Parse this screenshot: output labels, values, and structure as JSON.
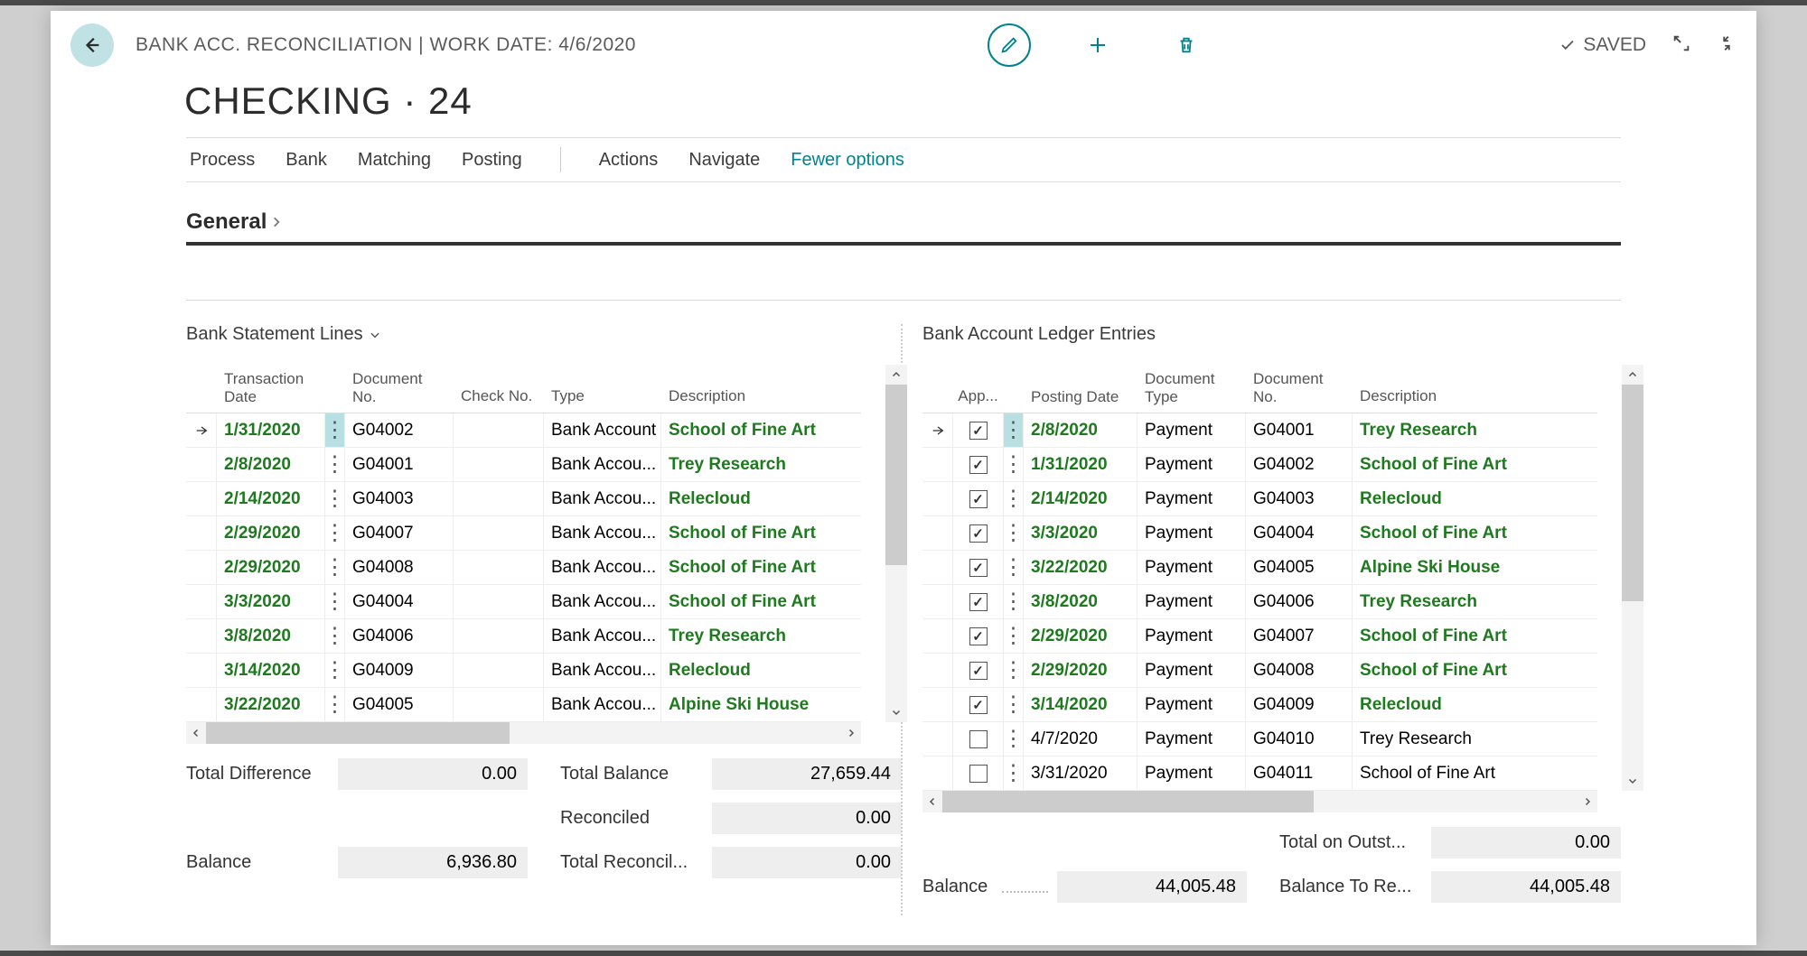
{
  "header": {
    "breadcrumb": "BANK ACC. RECONCILIATION | WORK DATE: 4/6/2020",
    "saved": "SAVED",
    "page_title": "CHECKING · 24"
  },
  "menu": {
    "process": "Process",
    "bank": "Bank",
    "matching": "Matching",
    "posting": "Posting",
    "actions": "Actions",
    "navigate": "Navigate",
    "fewer": "Fewer options"
  },
  "section": {
    "general": "General"
  },
  "left_panel": {
    "title": "Bank Statement Lines",
    "columns": {
      "transaction_date": "Transaction Date",
      "document_no": "Document No.",
      "check_no": "Check No.",
      "type": "Type",
      "description": "Description"
    },
    "rows": [
      {
        "date": "1/31/2020",
        "doc": "G04002",
        "check": "",
        "type": "Bank Account",
        "desc": "School of Fine Art",
        "matched": true,
        "selected": true
      },
      {
        "date": "2/8/2020",
        "doc": "G04001",
        "check": "",
        "type": "Bank Accou...",
        "desc": "Trey Research",
        "matched": true
      },
      {
        "date": "2/14/2020",
        "doc": "G04003",
        "check": "",
        "type": "Bank Accou...",
        "desc": "Relecloud",
        "matched": true
      },
      {
        "date": "2/29/2020",
        "doc": "G04007",
        "check": "",
        "type": "Bank Accou...",
        "desc": "School of Fine Art",
        "matched": true
      },
      {
        "date": "2/29/2020",
        "doc": "G04008",
        "check": "",
        "type": "Bank Accou...",
        "desc": "School of Fine Art",
        "matched": true
      },
      {
        "date": "3/3/2020",
        "doc": "G04004",
        "check": "",
        "type": "Bank Accou...",
        "desc": "School of Fine Art",
        "matched": true
      },
      {
        "date": "3/8/2020",
        "doc": "G04006",
        "check": "",
        "type": "Bank Accou...",
        "desc": "Trey Research",
        "matched": true
      },
      {
        "date": "3/14/2020",
        "doc": "G04009",
        "check": "",
        "type": "Bank Accou...",
        "desc": "Relecloud",
        "matched": true
      },
      {
        "date": "3/22/2020",
        "doc": "G04005",
        "check": "",
        "type": "Bank Accou...",
        "desc": "Alpine Ski House",
        "matched": true
      }
    ],
    "totals": {
      "total_difference_lbl": "Total Difference",
      "total_difference_val": "0.00",
      "total_balance_lbl": "Total Balance",
      "total_balance_val": "27,659.44",
      "reconciled_lbl": "Reconciled",
      "reconciled_val": "0.00",
      "balance_lbl": "Balance",
      "balance_val": "6,936.80",
      "total_reconcil_lbl": "Total Reconcil...",
      "total_reconcil_val": "0.00"
    }
  },
  "right_panel": {
    "title": "Bank Account Ledger Entries",
    "columns": {
      "app": "App...",
      "posting_date": "Posting Date",
      "document_type": "Document Type",
      "document_no": "Document No.",
      "description": "Description"
    },
    "rows": [
      {
        "app": true,
        "date": "2/8/2020",
        "dtype": "Payment",
        "doc": "G04001",
        "desc": "Trey Research",
        "matched": true,
        "selected": true
      },
      {
        "app": true,
        "date": "1/31/2020",
        "dtype": "Payment",
        "doc": "G04002",
        "desc": "School of Fine Art",
        "matched": true
      },
      {
        "app": true,
        "date": "2/14/2020",
        "dtype": "Payment",
        "doc": "G04003",
        "desc": "Relecloud",
        "matched": true
      },
      {
        "app": true,
        "date": "3/3/2020",
        "dtype": "Payment",
        "doc": "G04004",
        "desc": "School of Fine Art",
        "matched": true
      },
      {
        "app": true,
        "date": "3/22/2020",
        "dtype": "Payment",
        "doc": "G04005",
        "desc": "Alpine Ski House",
        "matched": true
      },
      {
        "app": true,
        "date": "3/8/2020",
        "dtype": "Payment",
        "doc": "G04006",
        "desc": "Trey Research",
        "matched": true
      },
      {
        "app": true,
        "date": "2/29/2020",
        "dtype": "Payment",
        "doc": "G04007",
        "desc": "School of Fine Art",
        "matched": true
      },
      {
        "app": true,
        "date": "2/29/2020",
        "dtype": "Payment",
        "doc": "G04008",
        "desc": "School of Fine Art",
        "matched": true
      },
      {
        "app": true,
        "date": "3/14/2020",
        "dtype": "Payment",
        "doc": "G04009",
        "desc": "Relecloud",
        "matched": true
      },
      {
        "app": false,
        "date": "4/7/2020",
        "dtype": "Payment",
        "doc": "G04010",
        "desc": "Trey Research",
        "matched": false
      },
      {
        "app": false,
        "date": "3/31/2020",
        "dtype": "Payment",
        "doc": "G04011",
        "desc": "School of Fine Art",
        "matched": false
      }
    ],
    "totals": {
      "total_on_outst_lbl": "Total on Outst...",
      "total_on_outst_val": "0.00",
      "balance_lbl": "Balance",
      "balance_val": "44,005.48",
      "balance_to_re_lbl": "Balance To Re...",
      "balance_to_re_val": "44,005.48"
    }
  }
}
